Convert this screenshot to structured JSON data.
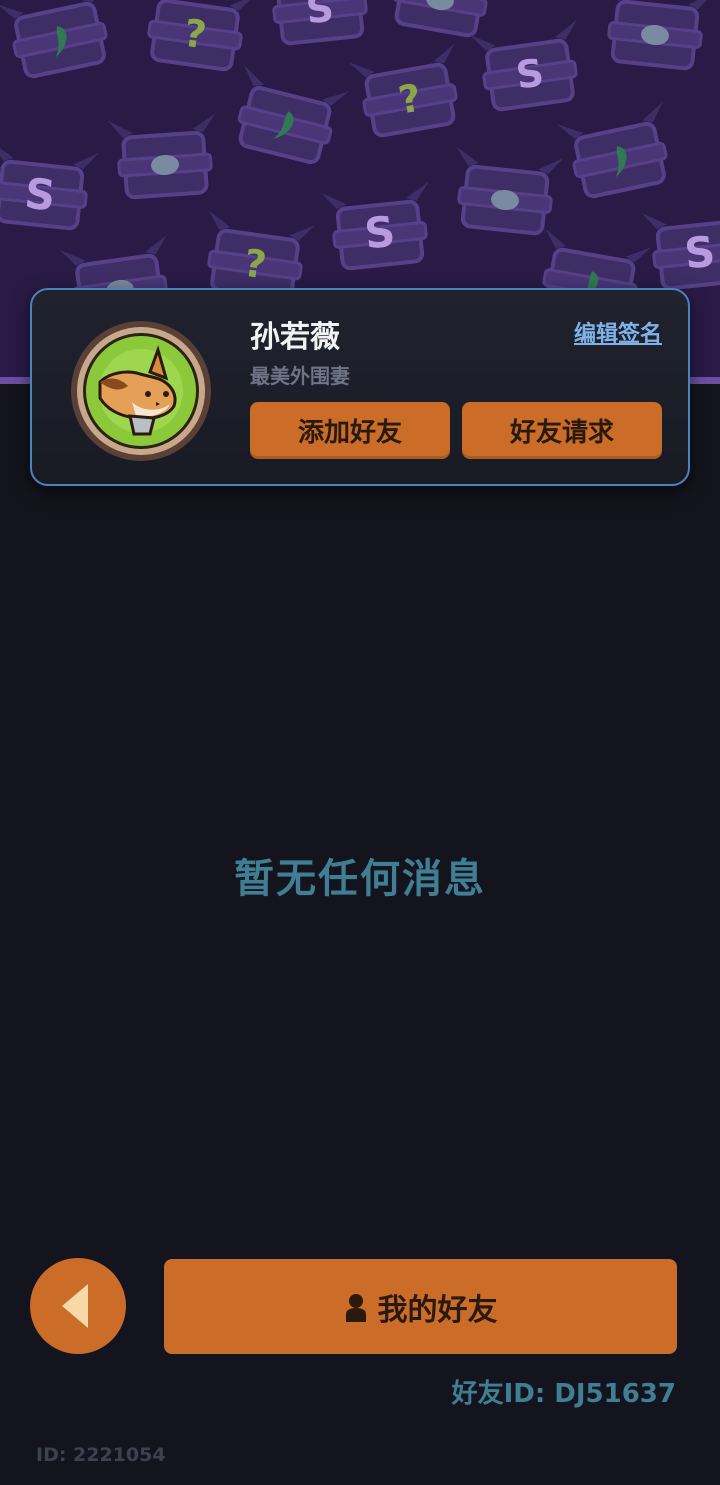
{
  "colors": {
    "background": "#13141d",
    "banner": "#2a1a45",
    "accent_orange": "#cb6c29",
    "card_border": "#4b83bf",
    "link_blue": "#7fb3e8",
    "teal_text": "#3f7e93"
  },
  "header_banner": {
    "pattern_icons": [
      "chest-s-icon",
      "chest-question-icon",
      "chest-gem-icon",
      "chest-coin-icon"
    ]
  },
  "profile": {
    "avatar_icon": "fox-avatar-icon",
    "username": "孙若薇",
    "signature": "最美外围妻",
    "edit_signature_label": "编辑签名",
    "add_friend_label": "添加好友",
    "friend_requests_label": "好友请求"
  },
  "messages": {
    "empty_text": "暂无任何消息"
  },
  "footer": {
    "back_icon": "back-arrow-icon",
    "my_friends_icon": "person-icon",
    "my_friends_label": "我的好友",
    "friend_id_text": "好友ID: DJ51637",
    "user_id_text": "ID: 2221054"
  }
}
